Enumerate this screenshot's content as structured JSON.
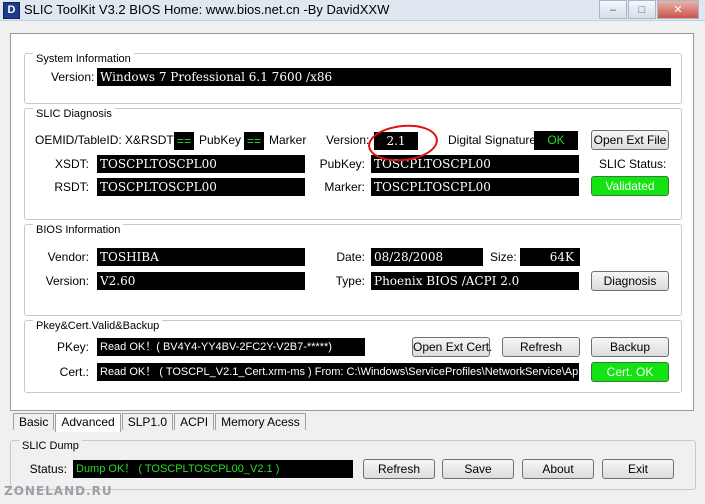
{
  "window": {
    "title": "SLIC ToolKit V3.2      BIOS Home: www.bios.net.cn   -By DavidXXW",
    "icon_letter": "D",
    "controls": {
      "minimize": "–",
      "maximize": "□",
      "close": "✕"
    }
  },
  "system_info": {
    "title": "System Information",
    "version_label": "Version:",
    "version_value": "Windows 7 Professional 6.1 7600 /x86"
  },
  "slic_diagnosis": {
    "title": "SLIC Diagnosis",
    "oemid_label": "OEMID/TableID:  X&RSDT",
    "oemid_eq": "==",
    "pubkey_label": "PubKey",
    "pubkey_eq": "==",
    "marker_label": "Marker",
    "version_label": "Version:",
    "version_value": "2.1",
    "digital_sig_label": "Digital Signature:",
    "digital_sig_value": "OK",
    "open_ext_file": "Open Ext File",
    "xsdt_label": "XSDT:",
    "xsdt_value": "TOSCPLTOSCPL00",
    "rsdt_label": "RSDT:",
    "rsdt_value": "TOSCPLTOSCPL00",
    "pubkey_field_label": "PubKey:",
    "pubkey_value": "TOSCPLTOSCPL00",
    "marker_field_label": "Marker:",
    "marker_value": "TOSCPLTOSCPL00",
    "slic_status_label": "SLIC Status:",
    "slic_status_value": "Validated"
  },
  "bios_info": {
    "title": "BIOS Information",
    "vendor_label": "Vendor:",
    "vendor_value": "TOSHIBA",
    "date_label": "Date:",
    "date_value": "08/28/2008",
    "size_label": "Size:",
    "size_value": "64K",
    "version_label": "Version:",
    "version_value": "V2.60",
    "type_label": "Type:",
    "type_value": "Phoenix BIOS /ACPI 2.0",
    "diagnosis_button": "Diagnosis"
  },
  "pkey_cert": {
    "title": "Pkey&Cert.Valid&Backup",
    "pkey_label": "PKey:",
    "pkey_value": "Read OK！( BV4Y4-YY4BV-2FC2Y-V2B7-*****)",
    "cert_label": "Cert.:",
    "cert_value": "Read OK！ ( TOSCPL_V2.1_Cert.xrm-ms )     From: C:\\Windows\\ServiceProfiles\\NetworkService\\Ap",
    "open_ext_cert": "Open Ext Cert.",
    "refresh": "Refresh",
    "backup": "Backup",
    "cert_status": "Cert. OK"
  },
  "tabs": [
    {
      "label": "Basic",
      "active": false
    },
    {
      "label": "Advanced",
      "active": true
    },
    {
      "label": "SLP1.0",
      "active": false
    },
    {
      "label": "ACPI",
      "active": false
    },
    {
      "label": "Memory Acess",
      "active": false
    }
  ],
  "slic_dump": {
    "title": "SLIC Dump",
    "status_label": "Status:",
    "status_value": "Dump OK！ ( TOSCPLTOSCPL00_V2.1 )",
    "refresh": "Refresh",
    "save": "Save",
    "about": "About",
    "exit": "Exit"
  },
  "watermark": "ZONELAND.RU",
  "colors": {
    "field_bg": "#000000",
    "ok_green": "#2bdc2b",
    "validated_bg": "#13e313",
    "annotation": "#dd1111"
  }
}
